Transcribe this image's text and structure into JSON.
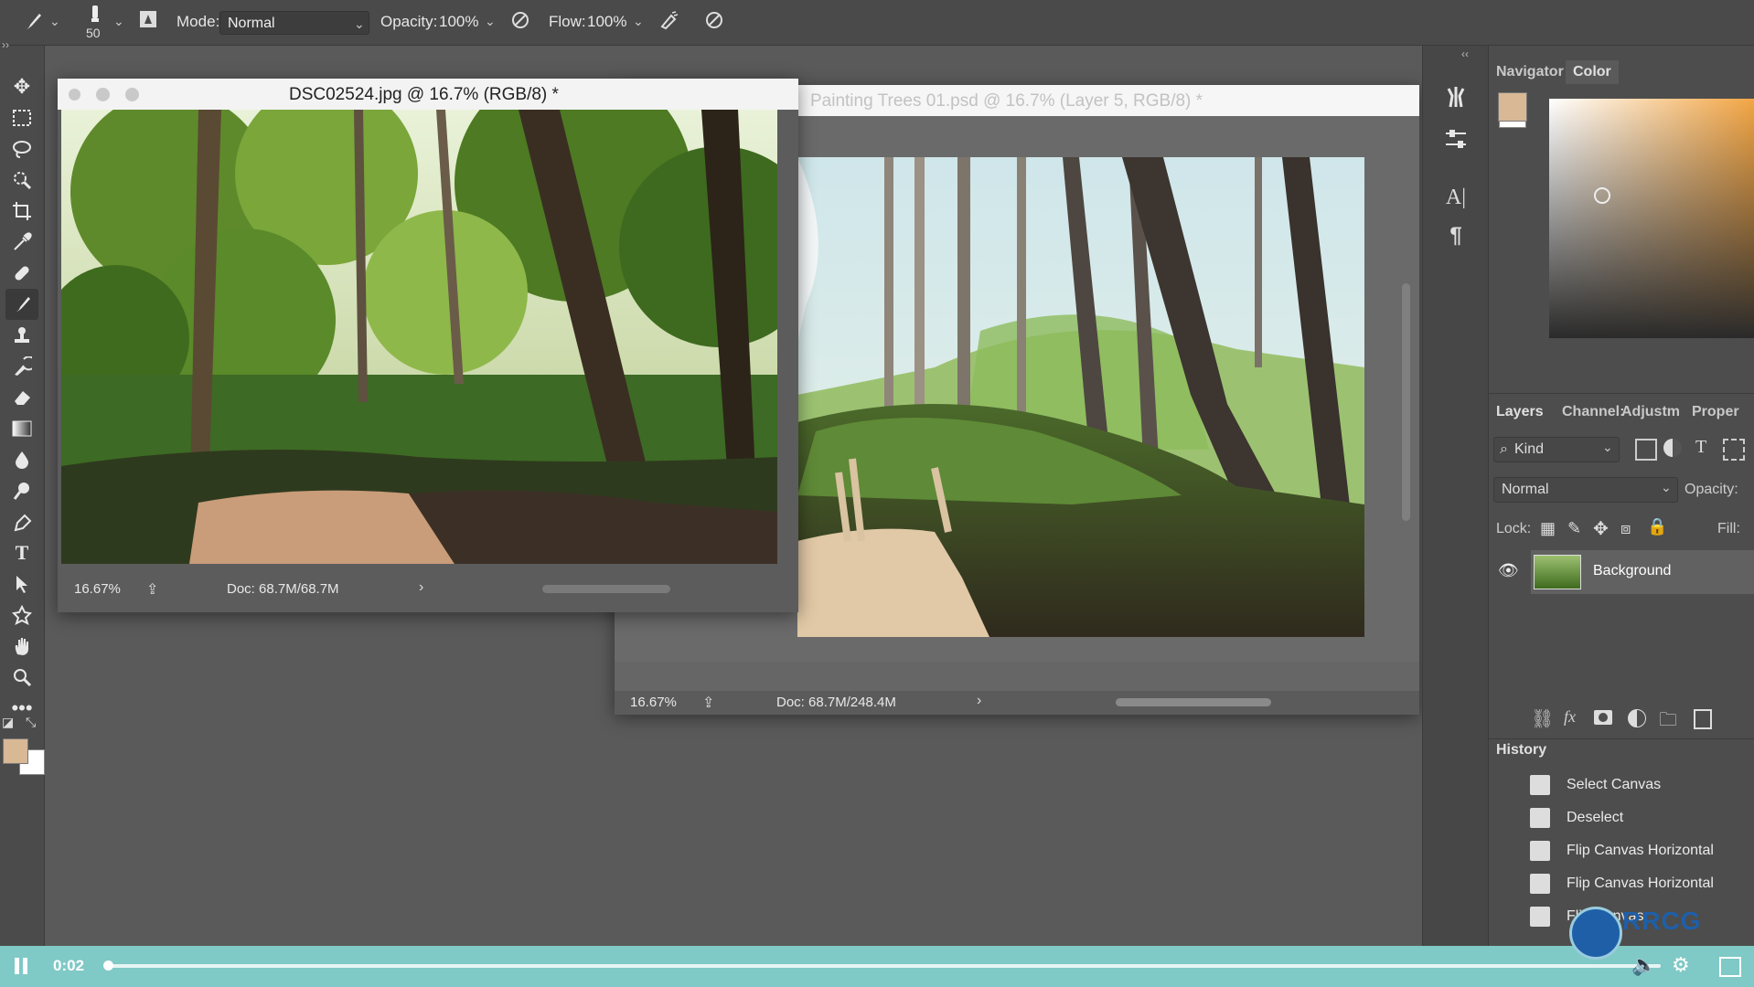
{
  "options_bar": {
    "brush_size": "50",
    "mode_label": "Mode:",
    "mode_value": "Normal",
    "opacity_label": "Opacity:",
    "opacity_value": "100%",
    "flow_label": "Flow:",
    "flow_value": "100%"
  },
  "doc1": {
    "title": "DSC02524.jpg @ 16.7% (RGB/8) *",
    "zoom": "16.67%",
    "doc_size": "Doc: 68.7M/68.7M"
  },
  "doc2": {
    "title": "Painting Trees 01.psd @ 16.7% (Layer 5, RGB/8) *",
    "zoom": "16.67%",
    "doc_size": "Doc: 68.7M/248.4M"
  },
  "panels": {
    "tab_navigator": "Navigator",
    "tab_color": "Color",
    "tab_layers": "Layers",
    "tab_channels": "Channel:",
    "tab_adjustments": "Adjustm",
    "tab_properties": "Proper",
    "kind_filter": "Kind",
    "blend_mode": "Normal",
    "opacity_label": "Opacity:",
    "lock_label": "Lock:",
    "fill_label": "Fill:",
    "layer_name": "Background",
    "history_title": "History",
    "history_items": [
      "Select Canvas",
      "Deselect",
      "Flip Canvas Horizontal",
      "Flip Canvas Horizontal",
      "Flip Canvas"
    ]
  },
  "colors": {
    "foreground": "#d8b895",
    "background": "#ffffff",
    "accent_bar": "#7fc9c6"
  },
  "video": {
    "time": "0:02",
    "progress": 0.0
  },
  "watermark": "RRCG 人人素材"
}
